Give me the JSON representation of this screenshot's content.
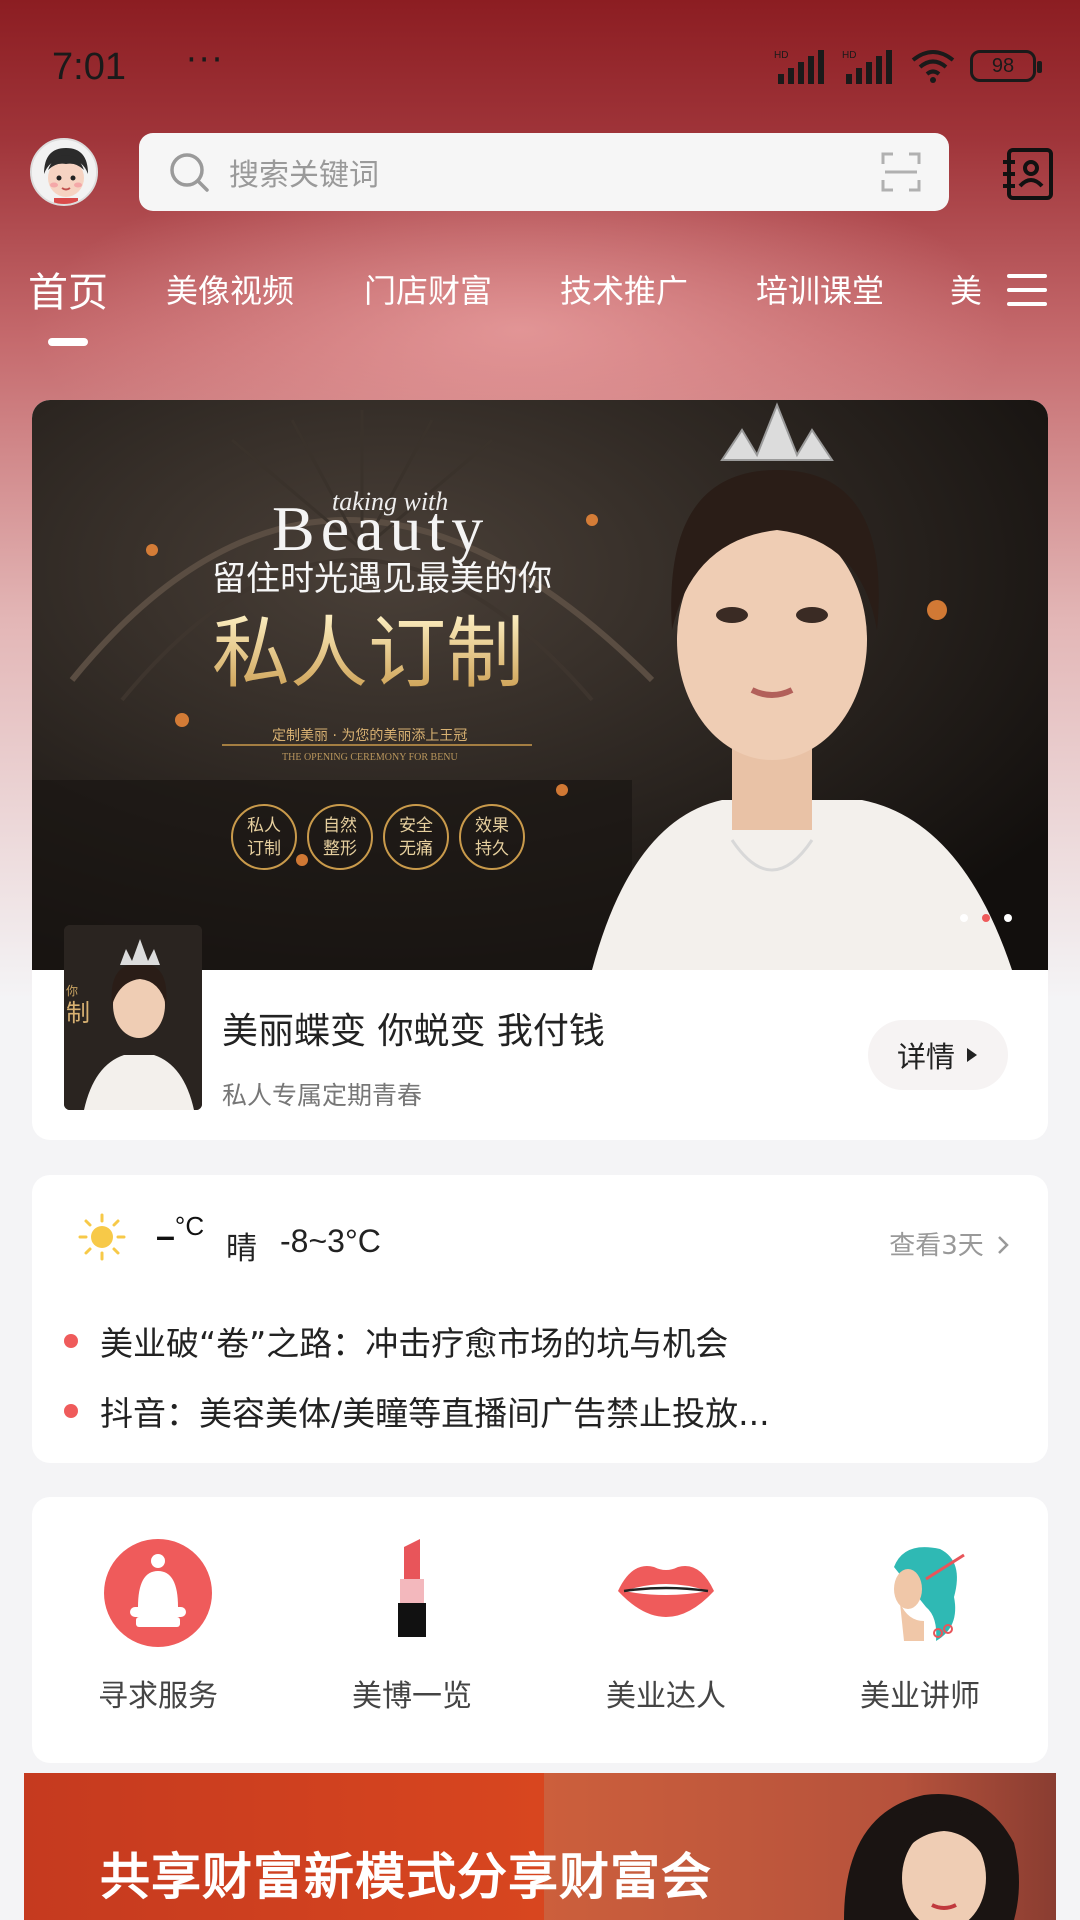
{
  "status": {
    "time": "7:01",
    "dots": "···",
    "signal1": "HD",
    "signal2": "HD",
    "battery": "98"
  },
  "header": {
    "search_placeholder": "搜索关键词"
  },
  "tabs": [
    {
      "label": "首页",
      "active": true
    },
    {
      "label": "美像视频"
    },
    {
      "label": "门店财富"
    },
    {
      "label": "技术推广"
    },
    {
      "label": "培训课堂"
    },
    {
      "label": "美"
    }
  ],
  "banner": {
    "en_small": "taking with",
    "en_big": "Beauty",
    "slogan": "留住时光遇见最美的你",
    "headline": "私人订制",
    "subline": "定制美丽 · 为您的美丽添上王冠",
    "subline_en": "THE OPENING CEREMONY FOR BENU",
    "circles": [
      "私人\n订制",
      "自然\n整形",
      "安全\n无痛",
      "效果\n持久"
    ],
    "slide_count": 3,
    "active_slide": 2
  },
  "promo": {
    "title": "美丽蝶变 你蜕变  我付钱",
    "subtitle": "私人专属定期青春",
    "detail_label": "详情"
  },
  "weather": {
    "temp_now": "–",
    "unit": "°C",
    "desc": "晴",
    "range": "-8~3°C",
    "view_more": "查看3天"
  },
  "news": [
    "美业破“卷”之路：冲击疗愈市场的坑与机会",
    "抖音：美容美体/美瞳等直播间广告禁止投放..."
  ],
  "services": [
    {
      "label": "寻求服务",
      "icon": "service-icon"
    },
    {
      "label": "美博一览",
      "icon": "lipstick-icon"
    },
    {
      "label": "美业达人",
      "icon": "lips-icon"
    },
    {
      "label": "美业讲师",
      "icon": "stylist-icon"
    }
  ],
  "bottom_banner": {
    "text": "共享财富新模式分享财富会"
  },
  "colors": {
    "accent": "#ef5b5b",
    "header_dark": "#8c1d22"
  }
}
